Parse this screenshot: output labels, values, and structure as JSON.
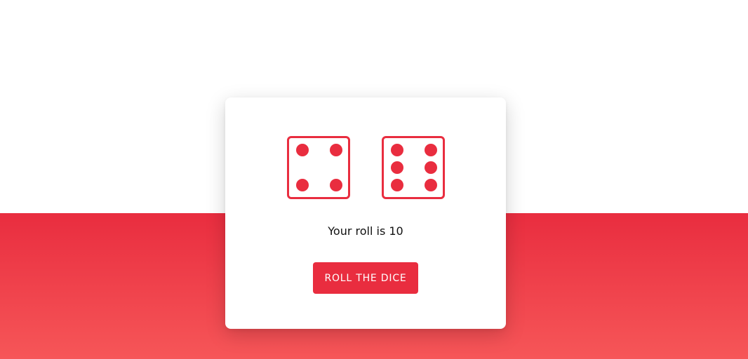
{
  "dice": [
    {
      "face": 4
    },
    {
      "face": 6
    }
  ],
  "result_text": "Your roll is 10",
  "button_label": "ROLL THE DICE",
  "colors": {
    "accent": "#e92d3f",
    "gradient_top": "#e92d3f",
    "gradient_bottom": "#f65658",
    "card_bg": "#ffffff",
    "page_bg": "#ffffff"
  }
}
